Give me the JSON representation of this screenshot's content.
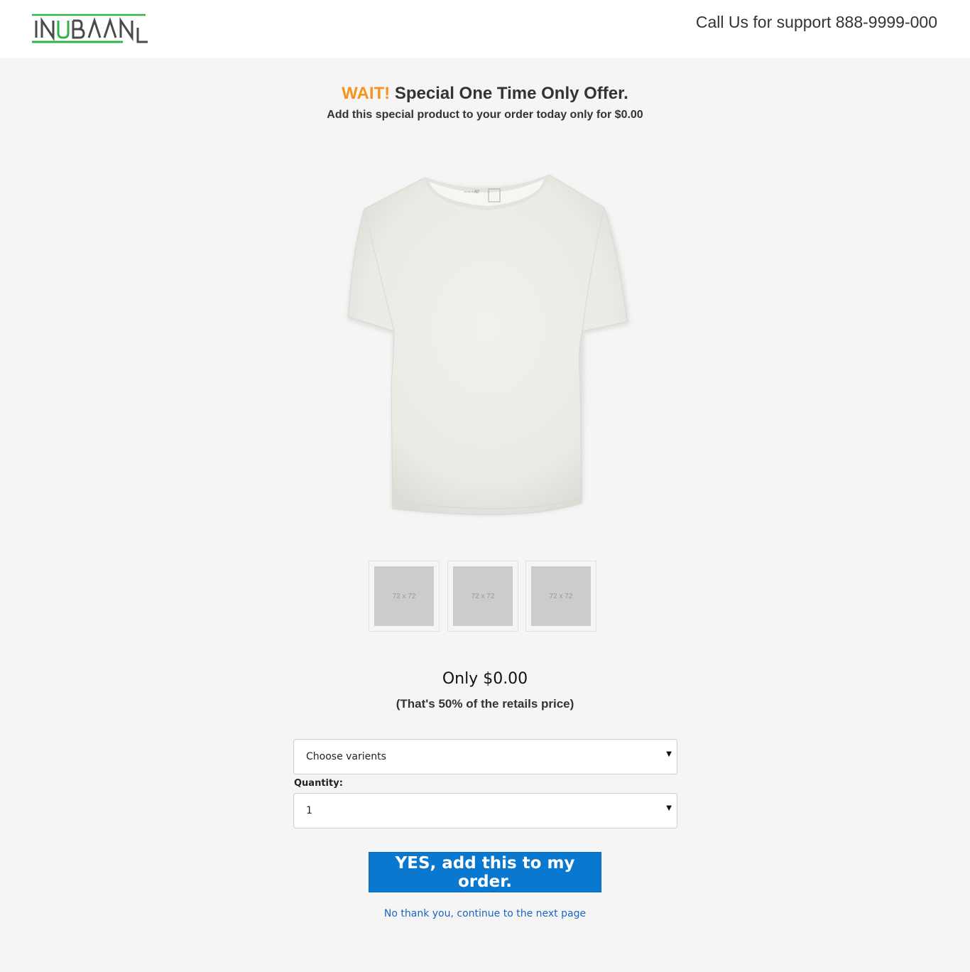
{
  "header": {
    "logo_text": "INUBAAN",
    "support_text": "Call Us for support 888-9999-000"
  },
  "offer": {
    "wait": "WAIT!",
    "headline": "Special One Time Only Offer.",
    "subline": "Add this special product to your order today only for $0.00"
  },
  "product": {
    "thumbnails": [
      {
        "label": "72 x 72"
      },
      {
        "label": "72 x 72"
      },
      {
        "label": "72 x 72"
      }
    ],
    "price": "Only $0.00",
    "price_note": "(That's 50% of the retails price)"
  },
  "form": {
    "variants_value": "Choose varients",
    "quantity_label": "Quantity:",
    "quantity_value": "1"
  },
  "actions": {
    "accept_label": "YES, add this to my order.",
    "decline_label": "No thank you, continue to the next page"
  },
  "colors": {
    "accent_orange": "#f7941d",
    "cta_blue": "#0a78cf",
    "link_blue": "#1a66c2",
    "logo_green": "#2fb34a"
  }
}
